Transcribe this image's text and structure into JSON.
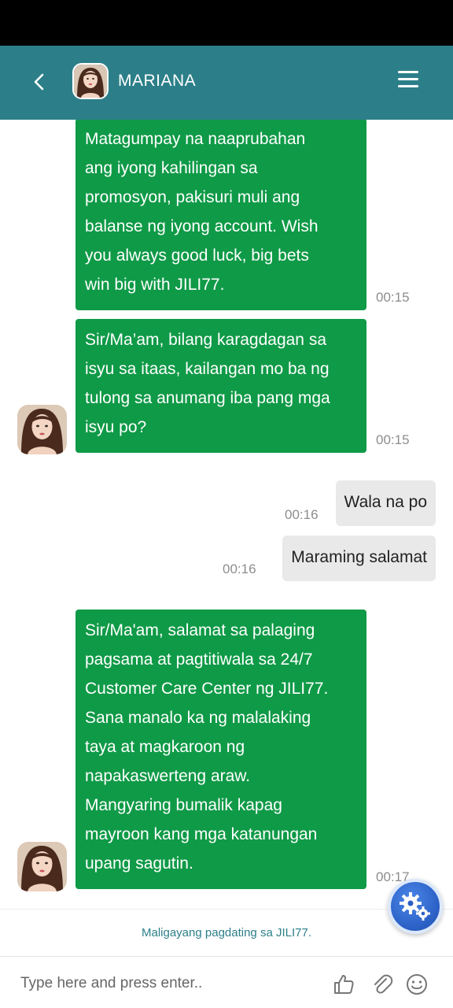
{
  "header": {
    "title": "MARIANA",
    "back_icon": "chevron-left-icon",
    "menu_icon": "hamburger-menu-icon"
  },
  "messages": [
    {
      "sender": "agent",
      "lines": [
        "Matagumpay na naaprubahan",
        "ang iyong kahilingan sa",
        "promosyon, pakisuri muli ang",
        "balanse ng iyong account. Wish",
        "you always good luck, big bets",
        "win big with JILI77."
      ],
      "time": "00:15"
    },
    {
      "sender": "agent",
      "lines": [
        "Sir/Ma’am, bilang karagdagan sa",
        "isyu sa itaas, kailangan mo ba ng",
        "tulong sa anumang iba pang mga",
        "isyu po?"
      ],
      "time": "00:15"
    },
    {
      "sender": "user",
      "text": "Wala na po",
      "time": "00:16"
    },
    {
      "sender": "user",
      "text": "Maraming salamat",
      "time": "00:16"
    },
    {
      "sender": "agent",
      "lines": [
        "Sir/Ma'am, salamat sa palaging",
        "pagsama at pagtitiwala sa 24/7",
        "Customer Care Center ng JILI77.",
        "Sana manalo ka ng malalaking",
        "taya at magkaroon ng",
        "napakaswerteng araw.",
        "Mangyaring bumalik kapag",
        "mayroon kang mga katanungan",
        "upang sagutin."
      ],
      "time": "00:17"
    }
  ],
  "welcome_text": "Maligayang pagdating sa JILI77.",
  "composer": {
    "placeholder": "Type here and press enter..",
    "icons": [
      "thumbs-up-icon",
      "paperclip-icon",
      "smiley-icon"
    ]
  },
  "colors": {
    "header": "#2c7f89",
    "agent_bubble": "#0f9a47",
    "user_bubble": "#e9e9e9",
    "fab": "#2a5fc4"
  }
}
